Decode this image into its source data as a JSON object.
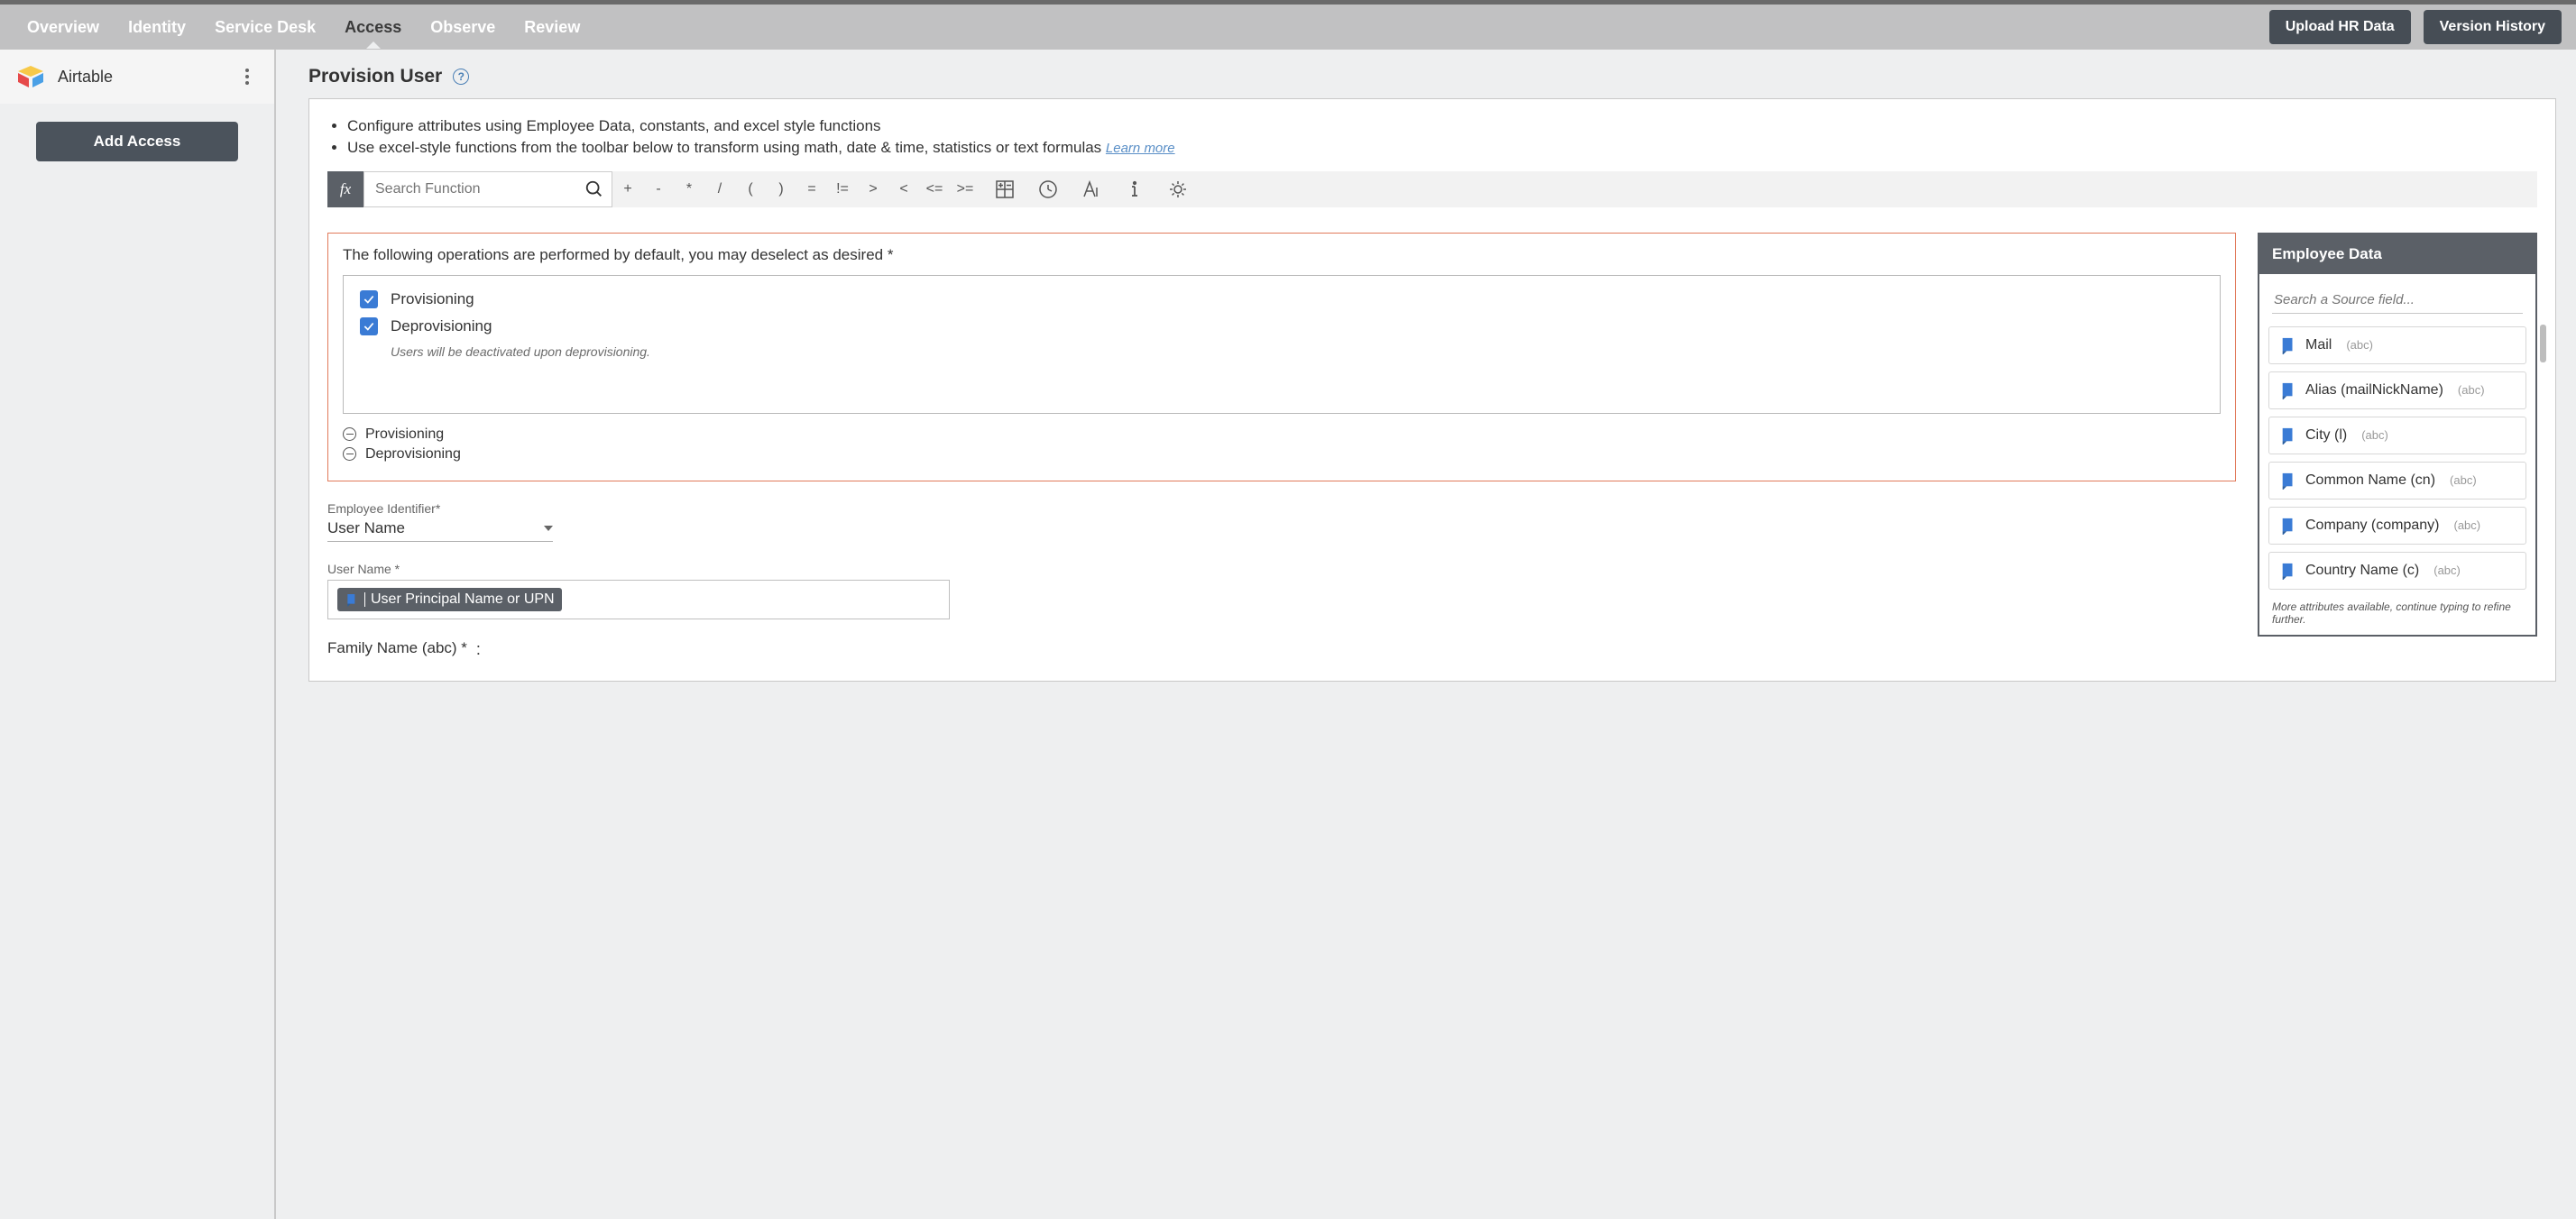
{
  "nav": {
    "tabs": [
      "Overview",
      "Identity",
      "Service Desk",
      "Access",
      "Observe",
      "Review"
    ],
    "active_index": 3,
    "actions": {
      "upload": "Upload HR Data",
      "version": "Version History"
    }
  },
  "sidebar": {
    "app_name": "Airtable",
    "add_access": "Add Access"
  },
  "page": {
    "title": "Provision User",
    "tips": {
      "line1": "Configure attributes using Employee Data, constants, and excel style functions",
      "line2": "Use excel-style functions from the toolbar below to transform using math, date & time, statistics or text formulas",
      "learn_more": "Learn more"
    },
    "fx_search_placeholder": "Search Function",
    "fx_ops": [
      "+",
      "-",
      "*",
      "/",
      "(",
      ")",
      "=",
      "!=",
      ">",
      "<",
      "<=",
      ">="
    ]
  },
  "ops": {
    "question": "The following operations are performed by default, you may deselect as desired *",
    "provisioning_label": "Provisioning",
    "deprovisioning_label": "Deprovisioning",
    "deprov_note": "Users will be deactivated upon deprovisioning.",
    "collapse_prov": "Provisioning",
    "collapse_deprov": "Deprovisioning"
  },
  "fields": {
    "emp_id_label": "Employee Identifier*",
    "emp_id_value": "User Name",
    "username_label": "User Name *",
    "username_token": "User Principal Name or UPN",
    "family_label": "Family Name (abc) *",
    "family_colon": ":"
  },
  "emp": {
    "header": "Employee Data",
    "search_placeholder": "Search a Source field...",
    "items": [
      {
        "name": "Mail",
        "type": "(abc)"
      },
      {
        "name": "Alias (mailNickName)",
        "type": "(abc)"
      },
      {
        "name": "City (l)",
        "type": "(abc)"
      },
      {
        "name": "Common Name (cn)",
        "type": "(abc)"
      },
      {
        "name": "Company (company)",
        "type": "(abc)"
      },
      {
        "name": "Country Name (c)",
        "type": "(abc)"
      }
    ],
    "more": "More attributes available, continue typing to refine further."
  }
}
